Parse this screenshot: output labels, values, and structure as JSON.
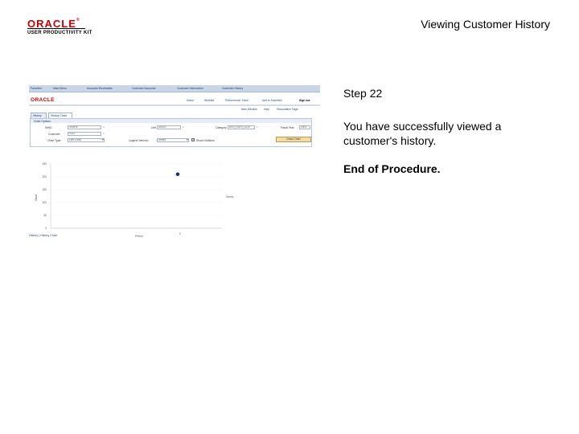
{
  "header": {
    "logo_word": "ORACLE",
    "logo_sub": "USER PRODUCTIVITY KIT",
    "title": "Viewing Customer History"
  },
  "step": {
    "number": "Step 22",
    "message": "You have successfully viewed a customer's history.",
    "end": "End of Procedure."
  },
  "screenshot": {
    "nav": [
      "Favorites",
      "Main Menu",
      "Accounts Receivable",
      "Customer Accounts",
      "Customer Information",
      "Customer History"
    ],
    "brand": "ORACLE",
    "brand_links": [
      "Home",
      "Worklist",
      "Performance Trace",
      "Add to Favorites",
      "Sign out"
    ],
    "top_links": [
      "New Window",
      "Help",
      "Personalize Page"
    ],
    "tabs": [
      "History",
      "History Chart"
    ],
    "panel_title": "Chart Options",
    "fields": {
      "setid_label": "SetID",
      "setid_value": "SHARE",
      "unit_label": "Unit",
      "unit_value": "US001",
      "category_label": "Category",
      "category_value": "AVG_DAYS_LATE",
      "fiscal_label": "Fiscal Year",
      "fiscal_value": "2003",
      "customer_label": "Customer",
      "customer_value": "0011",
      "chart_type_label": "Chart Type",
      "chart_type_value": "Line Chart",
      "legend_label": "Legend Selector",
      "legend_value": "Series",
      "show_label": "Show Gridlines",
      "draw_button": "Draw Chart"
    },
    "back_link": "History | History Chart",
    "chart_data": {
      "type": "scatter",
      "categories": [
        "0"
      ],
      "series": [
        {
          "name": "Series",
          "values": [
            210
          ],
          "color": "#1a2e8c"
        }
      ],
      "yticks": [
        "250",
        "200",
        "150",
        "100",
        "50",
        "0"
      ],
      "xtick": "0",
      "ylabel": "Value",
      "xlabel": "Period",
      "ylim": [
        0,
        250
      ]
    }
  }
}
